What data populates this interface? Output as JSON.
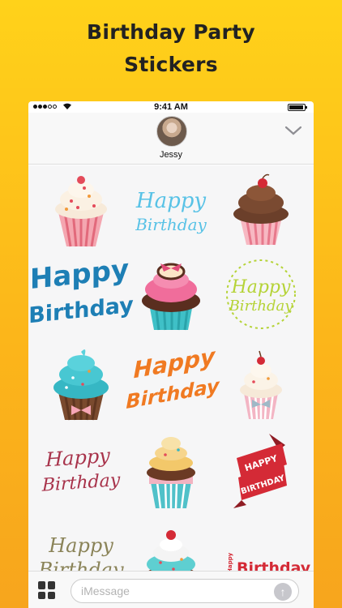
{
  "promo": {
    "title_line1": "Birthday Party",
    "title_line2": "Stickers"
  },
  "status_bar": {
    "time": "9:41 AM"
  },
  "conversation": {
    "contact_name": "Jessy"
  },
  "stickers": {
    "happy": "Happy",
    "birthday": "Birthday",
    "happy_caps": "HAPPY",
    "birthday_caps": "BIRTHDAY"
  },
  "compose": {
    "placeholder": "iMessage"
  },
  "colors": {
    "accent_blue": "#1e7fb5",
    "light_blue": "#58c2e6",
    "lime": "#b5d337",
    "orange": "#f07a22",
    "maroon": "#a8334b",
    "red": "#d42a36",
    "olive": "#8a8358"
  }
}
